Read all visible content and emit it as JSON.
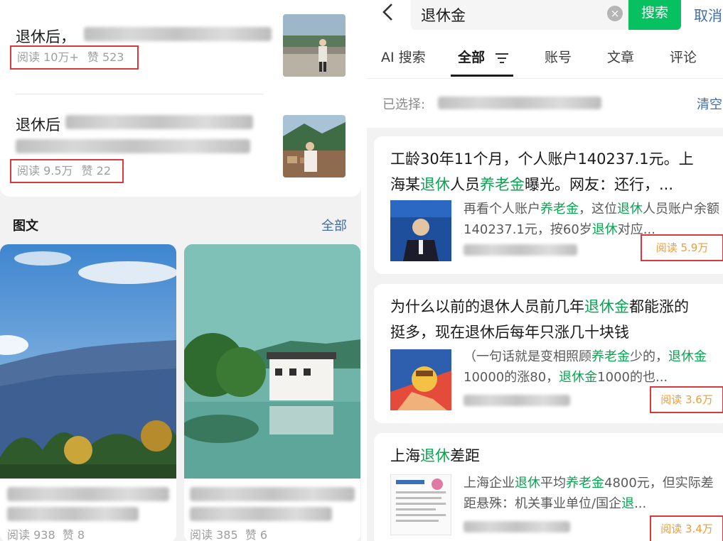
{
  "left": {
    "articles": [
      {
        "title": "退休后，",
        "reads": "阅读 10万+",
        "likes": "赞 523"
      },
      {
        "title": "退休后",
        "reads": "阅读 9.5万",
        "likes": "赞 22"
      }
    ],
    "section": {
      "label": "图文",
      "more": "全部"
    },
    "tiles": [
      {
        "reads": "阅读 938",
        "likes": "赞 8"
      },
      {
        "reads": "阅读 385",
        "likes": "赞 6"
      }
    ]
  },
  "right": {
    "back_icon": "chevron-left-icon",
    "search": {
      "query": "退休金",
      "clear_icon": "clear-icon",
      "button": "搜索",
      "cancel": "取消"
    },
    "tabs": [
      {
        "label": "AI 搜索"
      },
      {
        "label": "全部",
        "active": true
      },
      {
        "label": "账号"
      },
      {
        "label": "文章"
      },
      {
        "label": "评论"
      }
    ],
    "selected": {
      "label": "已选择:",
      "clear": "清空"
    },
    "results": [
      {
        "title_parts": [
          "工龄30年11个月，个人账户140237.1元。上海某",
          "退休",
          "人员",
          "养老金",
          "曝光。网友：还行，..."
        ],
        "snippet_parts": [
          "再看个人账户",
          "养老金",
          "，这位",
          "退休",
          "人员账户余额140237.1元，按60岁",
          "退休",
          "对应..."
        ],
        "reads": "阅读 5.9万"
      },
      {
        "title_parts": [
          "为什么以前的退休人员前几年",
          "退休金",
          "都能涨的挺多，现在退休后每年只涨几十块钱"
        ],
        "snippet_parts": [
          "（一句话就是变相照顾",
          "养老金",
          "少的，",
          "退休金",
          "10000的涨80，",
          "退休金",
          "1000的也..."
        ],
        "reads": "阅读 3.6万"
      },
      {
        "title_parts": [
          "上海",
          "退休",
          "差距"
        ],
        "snippet_parts": [
          "上海企业",
          "退休",
          "平均",
          "养老金",
          "4800元，但实际差距悬殊：机关事业单位/国企",
          "退",
          "..."
        ],
        "reads": "阅读 3.4万"
      }
    ]
  },
  "colors": {
    "accent_green": "#07c160",
    "highlight_green": "#07a550",
    "link_blue": "#3f6ea8",
    "annotation_red": "#d9383e",
    "reads_orange": "#f29c32"
  }
}
